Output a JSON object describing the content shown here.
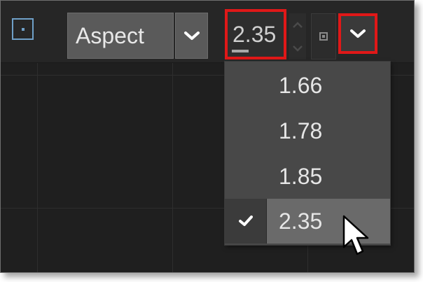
{
  "toolbar": {
    "mode_select": {
      "value": "Aspect"
    },
    "aspect_value": "2.35"
  },
  "menu": {
    "items": [
      {
        "label": "1.66",
        "checked": false
      },
      {
        "label": "1.78",
        "checked": false
      },
      {
        "label": "1.85",
        "checked": false
      },
      {
        "label": "2.35",
        "checked": true
      }
    ]
  },
  "colors": {
    "highlight": "#e01818",
    "toggle_accent": "#6fa0c8"
  }
}
